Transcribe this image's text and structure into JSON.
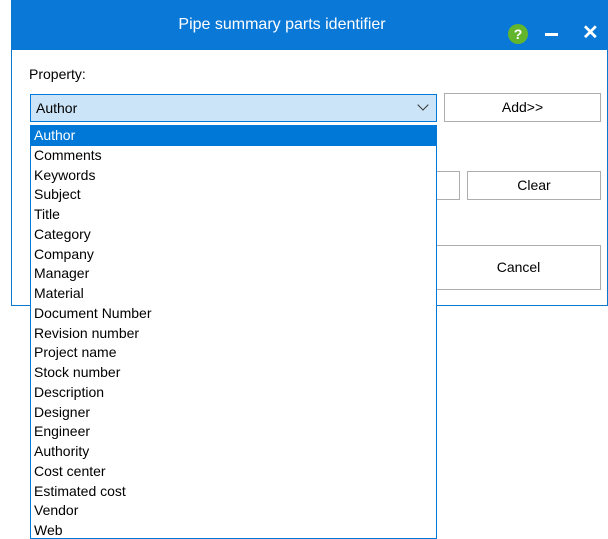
{
  "window": {
    "title": "Pipe summary parts identifier",
    "help_glyph": "?",
    "close_glyph": "✕"
  },
  "property": {
    "label": "Property:",
    "selected_value": "Author"
  },
  "buttons": {
    "add_label": "Add>>",
    "clear_label": "Clear",
    "cancel_label": "Cancel"
  },
  "dropdown": {
    "options": [
      "Author",
      "Comments",
      "Keywords",
      "Subject",
      "Title",
      "Category",
      "Company",
      "Manager",
      "Material",
      "Document Number",
      "Revision number",
      "Project name",
      "Stock number",
      "Description",
      "Designer",
      "Engineer",
      "Authority",
      "Cost center",
      "Estimated cost",
      "Vendor",
      "Web"
    ],
    "selected_index": 0
  },
  "colors": {
    "titlebar": "#0a78d7",
    "accent": "#0078d7",
    "help_icon": "#63b52c"
  }
}
